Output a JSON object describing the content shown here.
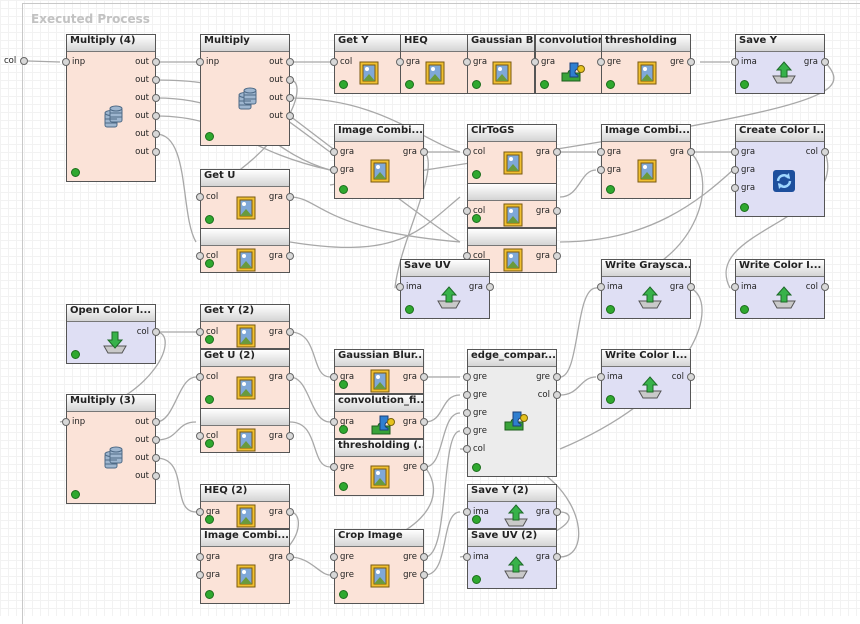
{
  "title": "Executed Process",
  "process_input": "col",
  "operators": [
    {
      "name": "Multiply (4)",
      "color": "orange",
      "icon": "database-icon",
      "ports_in": [
        "inp"
      ],
      "ports_out": [
        "out",
        "out",
        "out",
        "out",
        "out",
        "out"
      ]
    },
    {
      "name": "Multiply",
      "color": "orange",
      "icon": "database-icon",
      "ports_in": [
        "inp"
      ],
      "ports_out": [
        "out",
        "out",
        "out",
        "out"
      ]
    },
    {
      "name": "Get Y",
      "color": "orange",
      "icon": "picture-icon",
      "ports_in": [
        "col"
      ],
      "ports_out": []
    },
    {
      "name": "HEQ",
      "color": "orange",
      "icon": "picture-icon",
      "ports_in": [
        "gra"
      ],
      "ports_out": []
    },
    {
      "name": "Gaussian Blur",
      "color": "orange",
      "icon": "picture-icon",
      "ports_in": [
        "gra"
      ],
      "ports_out": []
    },
    {
      "name": "convolution",
      "color": "orange",
      "icon": "puzzle-icon",
      "ports_in": [
        "gra"
      ],
      "ports_out": []
    },
    {
      "name": "thresholding",
      "color": "orange",
      "icon": "picture-icon",
      "ports_in": [
        "gre"
      ],
      "ports_out": [
        "gre"
      ]
    },
    {
      "name": "Save Y",
      "color": "blue",
      "icon": "save-icon",
      "ports_in": [
        "ima"
      ],
      "ports_out": [
        "gra"
      ]
    },
    {
      "name": "Image Combi...",
      "color": "orange",
      "icon": "picture-icon",
      "ports_in": [
        "gra",
        "gra"
      ],
      "ports_out": [
        "gra"
      ]
    },
    {
      "name": "ClrToGS",
      "color": "orange",
      "icon": "picture-icon",
      "ports_in": [
        "col"
      ],
      "ports_out": [
        "gra"
      ]
    },
    {
      "name": "",
      "color": "orange",
      "icon": "picture-icon",
      "ports_in": [
        "col"
      ],
      "ports_out": [
        "gra"
      ]
    },
    {
      "name": "",
      "color": "orange",
      "icon": "picture-icon",
      "ports_in": [
        "col"
      ],
      "ports_out": [
        "gra"
      ]
    },
    {
      "name": "Image Combi...",
      "color": "orange",
      "icon": "picture-icon",
      "ports_in": [
        "gra",
        "gra"
      ],
      "ports_out": [
        "gra"
      ]
    },
    {
      "name": "Create Color I...",
      "color": "blue",
      "icon": "refresh-icon",
      "ports_in": [
        "gra",
        "gra",
        "gra"
      ],
      "ports_out": [
        "col"
      ]
    },
    {
      "name": "Get U",
      "color": "orange",
      "icon": "picture-icon",
      "ports_in": [
        "col"
      ],
      "ports_out": [
        "gra"
      ]
    },
    {
      "name": "",
      "color": "orange",
      "icon": "picture-icon",
      "ports_in": [
        "col"
      ],
      "ports_out": [
        "gra"
      ]
    },
    {
      "name": "Save UV",
      "color": "blue",
      "icon": "save-icon",
      "ports_in": [
        "ima"
      ],
      "ports_out": [
        "gra"
      ]
    },
    {
      "name": "Write Graysca...",
      "color": "blue",
      "icon": "save-icon",
      "ports_in": [
        "ima"
      ],
      "ports_out": [
        "gra"
      ]
    },
    {
      "name": "Write Color I...",
      "color": "blue",
      "icon": "save-icon",
      "ports_in": [
        "ima"
      ],
      "ports_out": [
        "col"
      ]
    },
    {
      "name": "Open Color I...",
      "color": "blue",
      "icon": "open-icon",
      "ports_in": [],
      "ports_out": [
        "col"
      ]
    },
    {
      "name": "Get Y (2)",
      "color": "orange",
      "icon": "picture-icon",
      "ports_in": [
        "col"
      ],
      "ports_out": [
        "gra"
      ]
    },
    {
      "name": "Get U (2)",
      "color": "orange",
      "icon": "picture-icon",
      "ports_in": [
        "col"
      ],
      "ports_out": [
        "gra"
      ]
    },
    {
      "name": "",
      "color": "orange",
      "icon": "picture-icon",
      "ports_in": [
        "col"
      ],
      "ports_out": [
        "gra"
      ]
    },
    {
      "name": "Multiply (3)",
      "color": "orange",
      "icon": "database-icon",
      "ports_in": [
        "inp"
      ],
      "ports_out": [
        "out",
        "out",
        "out",
        "out"
      ]
    },
    {
      "name": "Gaussian Blur...",
      "color": "orange",
      "icon": "picture-icon",
      "ports_in": [
        "gra"
      ],
      "ports_out": [
        "gra"
      ]
    },
    {
      "name": "convolution_fi...",
      "color": "orange",
      "icon": "puzzle-icon",
      "ports_in": [
        "gra"
      ],
      "ports_out": [
        "gra"
      ]
    },
    {
      "name": "thresholding (...",
      "color": "orange",
      "icon": "picture-icon",
      "ports_in": [
        "gre"
      ],
      "ports_out": [
        "gre"
      ]
    },
    {
      "name": "edge_compar...",
      "color": "gray",
      "icon": "puzzle-icon",
      "ports_in": [
        "gre",
        "gre",
        "gre",
        "gre",
        "col"
      ],
      "ports_out": [
        "gre",
        "col"
      ]
    },
    {
      "name": "Write Color I...",
      "color": "blue",
      "icon": "save-icon",
      "ports_in": [
        "ima"
      ],
      "ports_out": [
        "col"
      ]
    },
    {
      "name": "HEQ (2)",
      "color": "orange",
      "icon": "picture-icon",
      "ports_in": [
        "gra"
      ],
      "ports_out": [
        "gra"
      ]
    },
    {
      "name": "Image Combi...",
      "color": "orange",
      "icon": "picture-icon",
      "ports_in": [
        "gra",
        "gra"
      ],
      "ports_out": [
        "gra"
      ]
    },
    {
      "name": "Crop Image",
      "color": "orange",
      "icon": "picture-icon",
      "ports_in": [
        "gre",
        "gre"
      ],
      "ports_out": [
        "gre",
        "gre"
      ]
    },
    {
      "name": "Save Y (2)",
      "color": "blue",
      "icon": "save-icon",
      "ports_in": [
        "ima"
      ],
      "ports_out": [
        "gra"
      ]
    },
    {
      "name": "Save UV (2)",
      "color": "blue",
      "icon": "save-icon",
      "ports_in": [
        "ima"
      ],
      "ports_out": [
        "gra"
      ]
    }
  ]
}
